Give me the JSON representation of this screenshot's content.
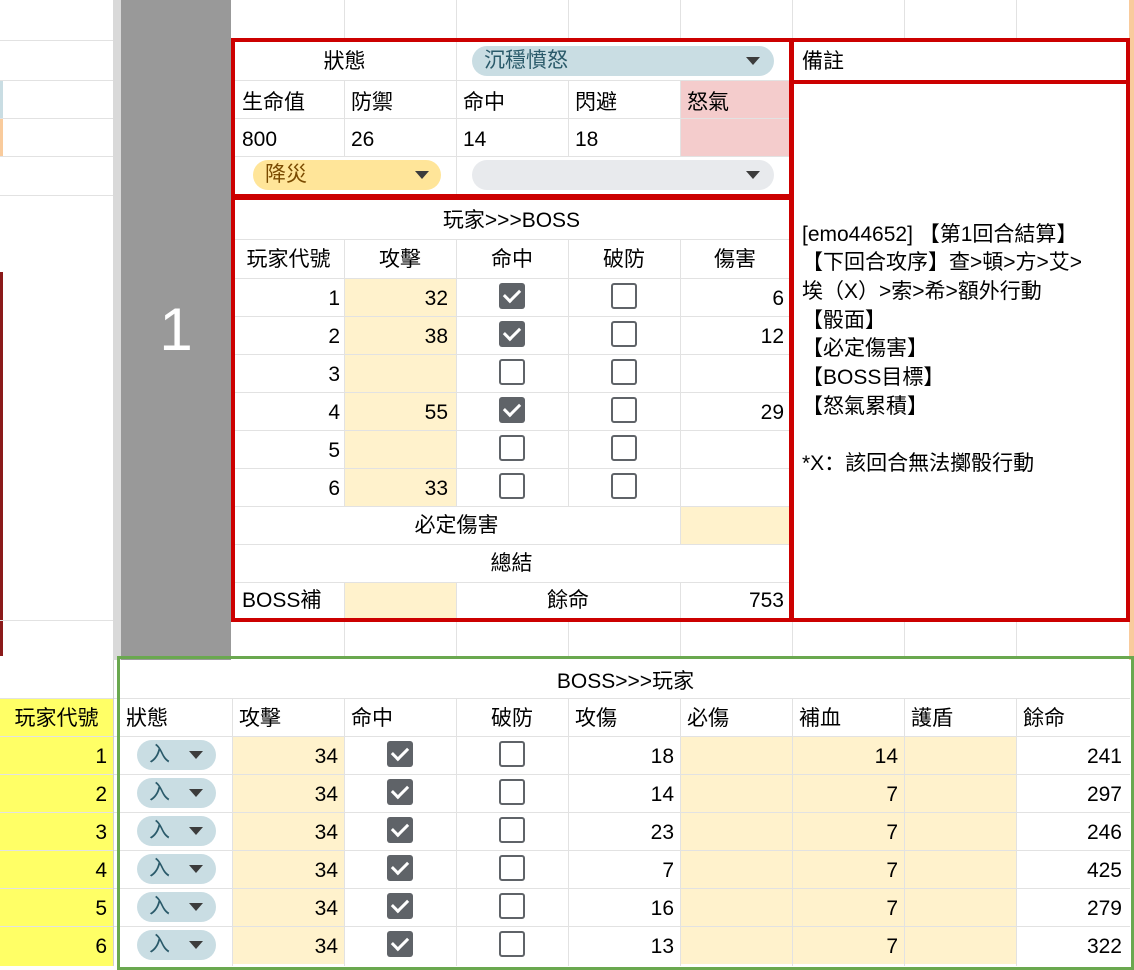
{
  "colors": {
    "cell_peach": "#fff2cc",
    "cell_pink": "#f4cccc",
    "header_yellow": "#ffff66",
    "chip_blue": "#c9dde3",
    "chip_orange": "#ffe599",
    "chip_gray": "#e8eaed",
    "red_border": "#cc0000",
    "green_border": "#6aa84f",
    "round_block": "#999999"
  },
  "round": {
    "number": "1"
  },
  "status": {
    "label": "狀態",
    "value": "沉穩憤怒",
    "dropdown2_value": "降災",
    "dropdown3_value": ""
  },
  "stats": {
    "headers": [
      "生命值",
      "防禦",
      "命中",
      "閃避",
      "怒氣"
    ],
    "values": [
      "800",
      "26",
      "14",
      "18",
      ""
    ]
  },
  "notes": {
    "title": "備註",
    "lines": [
      "[emo44652] 【第1回合結算】",
      "【下回合攻序】查>頓>方>艾>",
      "埃（X）>索>希>額外行動",
      "【骰面】",
      "【必定傷害】",
      "【BOSS目標】",
      "【怒氣累積】",
      "",
      "*X：該回合無法擲骰行動"
    ]
  },
  "p2b": {
    "title": "玩家>>>BOSS",
    "headers": [
      "玩家代號",
      "攻擊",
      "命中",
      "破防",
      "傷害"
    ],
    "rows": [
      {
        "id": "1",
        "attack": "32",
        "hit": true,
        "break": false,
        "damage": "6"
      },
      {
        "id": "2",
        "attack": "38",
        "hit": true,
        "break": false,
        "damage": "12"
      },
      {
        "id": "3",
        "attack": "",
        "hit": false,
        "break": false,
        "damage": ""
      },
      {
        "id": "4",
        "attack": "55",
        "hit": true,
        "break": false,
        "damage": "29"
      },
      {
        "id": "5",
        "attack": "",
        "hit": false,
        "break": false,
        "damage": ""
      },
      {
        "id": "6",
        "attack": "33",
        "hit": false,
        "break": false,
        "damage": ""
      }
    ],
    "fixed_damage_label": "必定傷害",
    "fixed_damage_value": "",
    "summary_label": "總結",
    "boss_heal_label": "BOSS補",
    "boss_heal_value": "",
    "remaining_label": "餘命",
    "remaining_value": "753"
  },
  "b2p": {
    "title": "BOSS>>>玩家",
    "headers": [
      "玩家代號",
      "狀態",
      "攻擊",
      "命中",
      "破防",
      "攻傷",
      "必傷",
      "補血",
      "護盾",
      "餘命"
    ],
    "rows": [
      {
        "id": "1",
        "status": "入",
        "attack": "34",
        "hit": true,
        "break": false,
        "atk_dmg": "18",
        "fixed_dmg": "",
        "heal": "14",
        "shield": "",
        "remaining": "241"
      },
      {
        "id": "2",
        "status": "入",
        "attack": "34",
        "hit": true,
        "break": false,
        "atk_dmg": "14",
        "fixed_dmg": "",
        "heal": "7",
        "shield": "",
        "remaining": "297"
      },
      {
        "id": "3",
        "status": "入",
        "attack": "34",
        "hit": true,
        "break": false,
        "atk_dmg": "23",
        "fixed_dmg": "",
        "heal": "7",
        "shield": "",
        "remaining": "246"
      },
      {
        "id": "4",
        "status": "入",
        "attack": "34",
        "hit": true,
        "break": false,
        "atk_dmg": "7",
        "fixed_dmg": "",
        "heal": "7",
        "shield": "",
        "remaining": "425"
      },
      {
        "id": "5",
        "status": "入",
        "attack": "34",
        "hit": true,
        "break": false,
        "atk_dmg": "16",
        "fixed_dmg": "",
        "heal": "7",
        "shield": "",
        "remaining": "279"
      },
      {
        "id": "6",
        "status": "入",
        "attack": "34",
        "hit": true,
        "break": false,
        "atk_dmg": "13",
        "fixed_dmg": "",
        "heal": "7",
        "shield": "",
        "remaining": "322"
      }
    ]
  }
}
